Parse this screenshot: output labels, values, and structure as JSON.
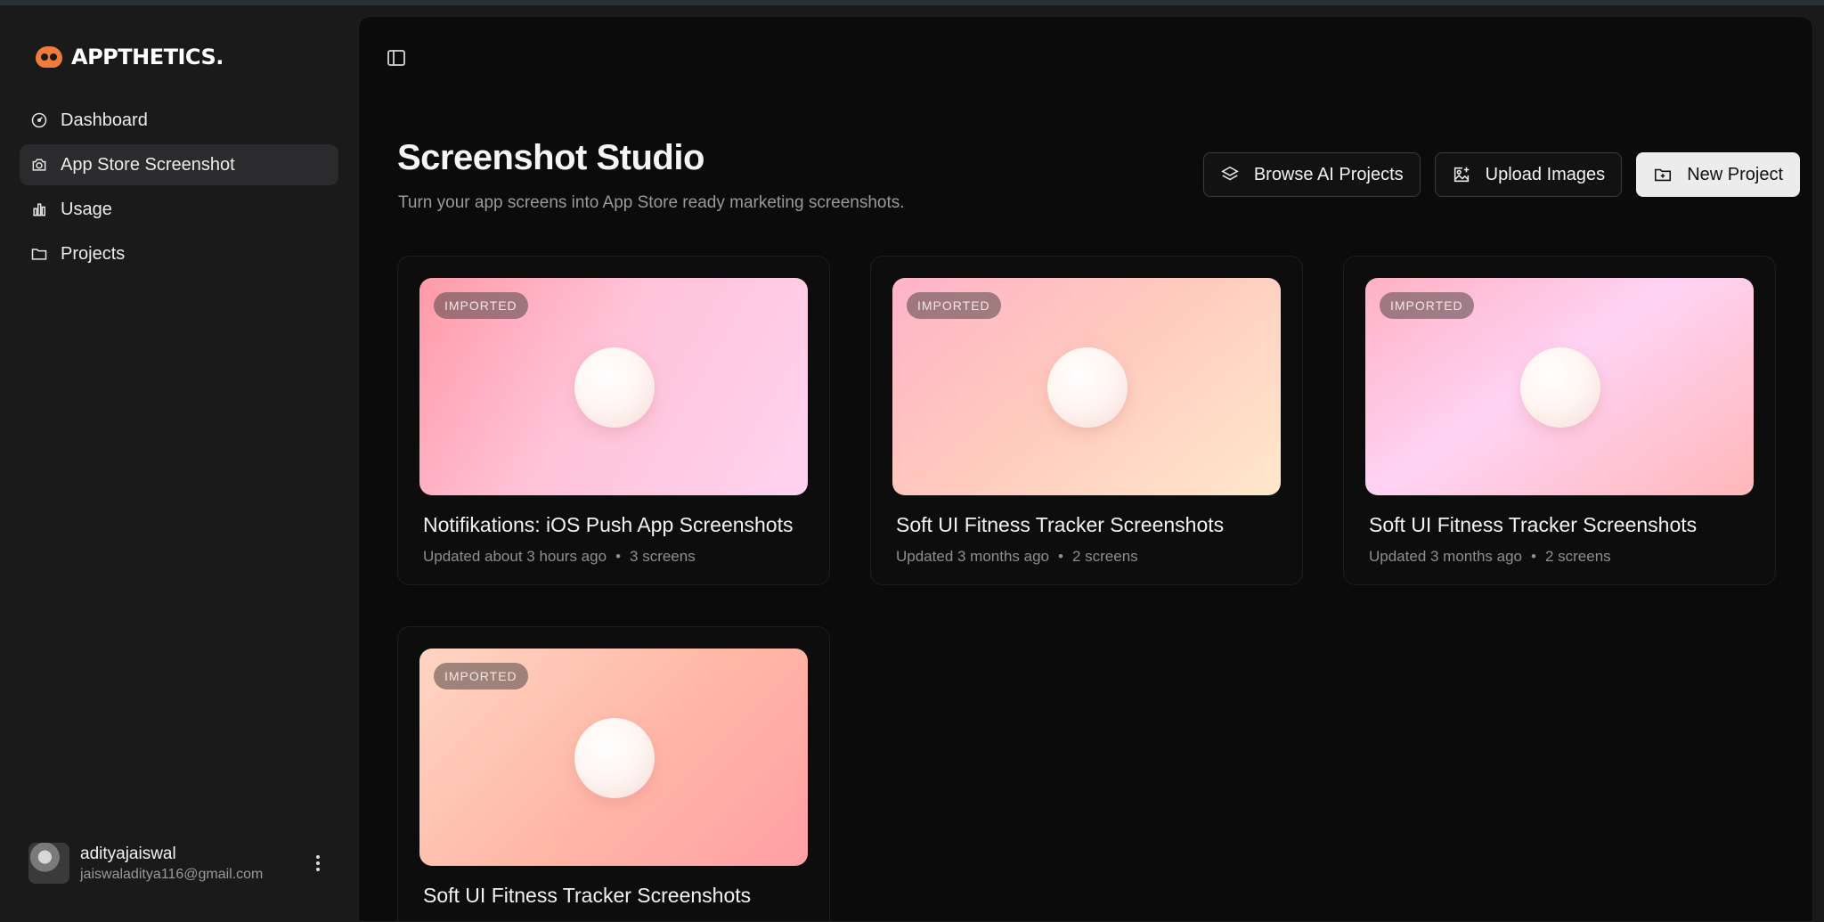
{
  "brand": {
    "name": "APPTHETICS."
  },
  "sidebar": {
    "items": [
      {
        "label": "Dashboard",
        "icon": "gauge-icon"
      },
      {
        "label": "App Store Screenshot",
        "icon": "camera-icon",
        "active": true
      },
      {
        "label": "Usage",
        "icon": "bar-chart-icon"
      },
      {
        "label": "Projects",
        "icon": "folder-icon"
      }
    ]
  },
  "user": {
    "name": "adityajaiswal",
    "email": "jaiswaladitya116@gmail.com"
  },
  "header": {
    "title": "Screenshot Studio",
    "subtitle": "Turn your app screens into App Store ready marketing screenshots."
  },
  "actions": {
    "browse_label": "Browse AI Projects",
    "upload_label": "Upload Images",
    "new_label": "New Project"
  },
  "projects": [
    {
      "badge": "IMPORTED",
      "title": "Notifikations: iOS Push App Screenshots",
      "updated": "Updated about 3 hours ago",
      "screens": "3 screens"
    },
    {
      "badge": "IMPORTED",
      "title": "Soft UI Fitness Tracker Screenshots",
      "updated": "Updated 3 months ago",
      "screens": "2 screens"
    },
    {
      "badge": "IMPORTED",
      "title": "Soft UI Fitness Tracker Screenshots",
      "updated": "Updated 3 months ago",
      "screens": "2 screens"
    },
    {
      "badge": "IMPORTED",
      "title": "Soft UI Fitness Tracker Screenshots",
      "updated": "",
      "screens": ""
    }
  ],
  "colors": {
    "accent": "#f07b3a",
    "background": "#0b0b0b",
    "sidebar": "#1a1a1a"
  }
}
